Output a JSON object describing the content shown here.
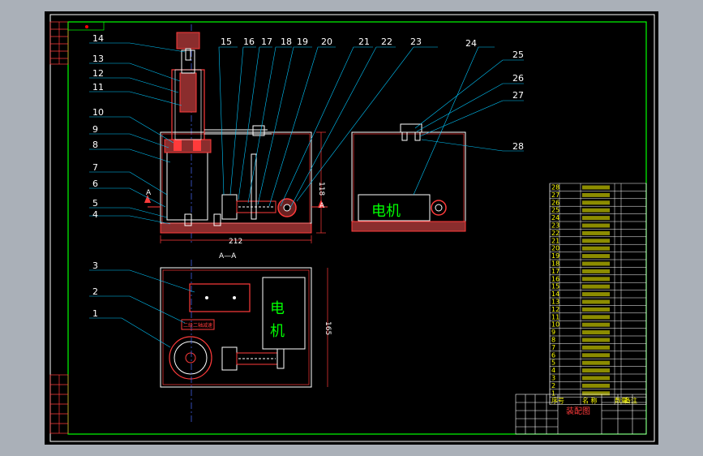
{
  "colors": {
    "background": "#aab0b8",
    "sheet": "#000000",
    "frame": "#00ff00",
    "leader": "#00c8ff",
    "part": "#ff3b3b",
    "hatch": "#8b2d2d",
    "text": "#ffffff",
    "motor_text": "#00ff00",
    "table_text": "#ffff00",
    "center_line": "#4a6cff"
  },
  "callouts": {
    "left": [
      "14",
      "13",
      "12",
      "11",
      "10",
      "9",
      "8",
      "7",
      "6",
      "5",
      "4",
      "3",
      "2",
      "1"
    ],
    "top": [
      "15",
      "16",
      "17",
      "18",
      "19",
      "20",
      "21",
      "22",
      "23",
      "24"
    ],
    "right": [
      "25",
      "26",
      "27",
      "28"
    ]
  },
  "dimensions": {
    "width_front": "212",
    "height_front": "118",
    "depth_plan": "165"
  },
  "section": {
    "label_a": "A",
    "view_title": "A—A"
  },
  "motor_label": "电机",
  "motor_label_plan": [
    "电",
    "机"
  ],
  "plate_label": "二级二轴减速",
  "parts_table": {
    "rows": [
      "28",
      "27",
      "26",
      "25",
      "24",
      "23",
      "22",
      "21",
      "20",
      "19",
      "18",
      "17",
      "16",
      "15",
      "14",
      "13",
      "12",
      "11",
      "10",
      "9",
      "8",
      "7",
      "6",
      "5",
      "4",
      "3",
      "2",
      "1"
    ],
    "header": [
      "序号",
      "名 称",
      "数量",
      "备注"
    ]
  },
  "title_block": {
    "drawing_name": "装配图"
  }
}
